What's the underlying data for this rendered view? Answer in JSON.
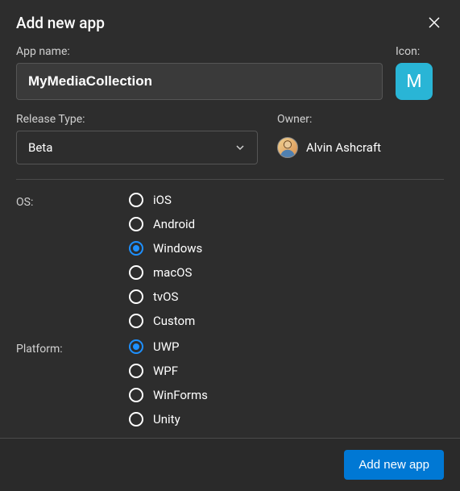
{
  "dialog": {
    "title": "Add new app"
  },
  "fields": {
    "app_name_label": "App name:",
    "app_name_value": "MyMediaCollection",
    "icon_label": "Icon:",
    "icon_letter": "M",
    "release_type_label": "Release Type:",
    "release_type_value": "Beta",
    "owner_label": "Owner:",
    "owner_name": "Alvin Ashcraft"
  },
  "os": {
    "label": "OS:",
    "selected": "Windows",
    "options": [
      {
        "label": "iOS"
      },
      {
        "label": "Android"
      },
      {
        "label": "Windows"
      },
      {
        "label": "macOS"
      },
      {
        "label": "tvOS"
      },
      {
        "label": "Custom"
      }
    ]
  },
  "platform": {
    "label": "Platform:",
    "selected": "UWP",
    "options": [
      {
        "label": "UWP"
      },
      {
        "label": "WPF"
      },
      {
        "label": "WinForms"
      },
      {
        "label": "Unity"
      }
    ]
  },
  "footer": {
    "submit_label": "Add new app"
  },
  "colors": {
    "accent": "#0078d4",
    "icon_tile": "#29b5d6",
    "radio_selected": "#1e90ff"
  }
}
